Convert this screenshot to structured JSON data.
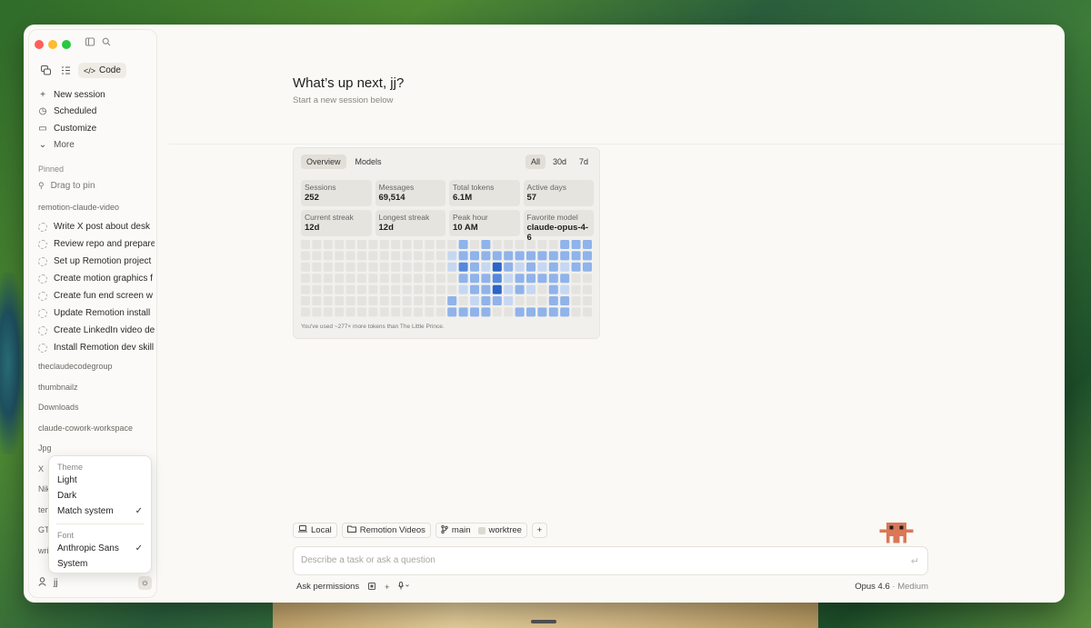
{
  "sidebar": {
    "mode_code_label": "Code",
    "nav": [
      {
        "icon": "plus-icon",
        "label": "New session"
      },
      {
        "icon": "clock-icon",
        "label": "Scheduled"
      },
      {
        "icon": "briefcase-icon",
        "label": "Customize"
      },
      {
        "icon": "chevron-down-icon",
        "label": "More"
      }
    ],
    "pinned_label": "Pinned",
    "pin_hint": "Drag to pin",
    "group_main": "remotion-claude-video",
    "sessions": [
      "Write X post about desk",
      "Review repo and prepare",
      "Set up Remotion project",
      "Create motion graphics f",
      "Create fun end screen w",
      "Update Remotion install",
      "Create LinkedIn video de",
      "Install Remotion dev skill"
    ],
    "groups": [
      "theclaudecodegroup",
      "thumbnailz",
      "Downloads",
      "claude-cowork-workspace",
      "Jpg",
      "X",
      "Nik",
      "ten",
      "GTN",
      "writ"
    ],
    "user_name": "jj"
  },
  "popup": {
    "theme_label": "Theme",
    "theme_options": [
      "Light",
      "Dark",
      "Match system"
    ],
    "font_label": "Font",
    "font_options": [
      "Anthropic Sans",
      "System"
    ]
  },
  "main": {
    "greeting": "What’s up next, jj?",
    "subtitle": "Start a new session below"
  },
  "stats": {
    "tabs": [
      "Overview",
      "Models"
    ],
    "ranges": [
      "All",
      "30d",
      "7d"
    ],
    "cards": [
      {
        "label": "Sessions",
        "value": "252"
      },
      {
        "label": "Messages",
        "value": "69,514"
      },
      {
        "label": "Total tokens",
        "value": "6.1M"
      },
      {
        "label": "Active days",
        "value": "57"
      },
      {
        "label": "Current streak",
        "value": "12d"
      },
      {
        "label": "Longest streak",
        "value": "12d"
      },
      {
        "label": "Peak hour",
        "value": "10 AM"
      },
      {
        "label": "Favorite model",
        "value": "claude-opus-4-6"
      }
    ],
    "heatmap_levels": [
      [
        0,
        0,
        0,
        0,
        0,
        0,
        0,
        0,
        0,
        0,
        0,
        0,
        0,
        0,
        2,
        0,
        2,
        0,
        0,
        0,
        0,
        0,
        0,
        2,
        2,
        2
      ],
      [
        0,
        0,
        0,
        0,
        0,
        0,
        0,
        0,
        0,
        0,
        0,
        0,
        0,
        1,
        2,
        2,
        2,
        2,
        2,
        2,
        2,
        2,
        2,
        2,
        2,
        2
      ],
      [
        0,
        0,
        0,
        0,
        0,
        0,
        0,
        0,
        0,
        0,
        0,
        0,
        0,
        1,
        3,
        2,
        1,
        4,
        2,
        1,
        2,
        1,
        2,
        1,
        2,
        2
      ],
      [
        0,
        0,
        0,
        0,
        0,
        0,
        0,
        0,
        0,
        0,
        0,
        0,
        0,
        0,
        2,
        2,
        2,
        3,
        1,
        2,
        2,
        2,
        2,
        2,
        0,
        0
      ],
      [
        0,
        0,
        0,
        0,
        0,
        0,
        0,
        0,
        0,
        0,
        0,
        0,
        0,
        0,
        1,
        2,
        2,
        4,
        1,
        2,
        1,
        0,
        2,
        1,
        0,
        0
      ],
      [
        0,
        0,
        0,
        0,
        0,
        0,
        0,
        0,
        0,
        0,
        0,
        0,
        0,
        2,
        0,
        1,
        2,
        2,
        1,
        0,
        0,
        0,
        2,
        2,
        0,
        0
      ],
      [
        0,
        0,
        0,
        0,
        0,
        0,
        0,
        0,
        0,
        0,
        0,
        0,
        0,
        2,
        2,
        2,
        2,
        0,
        0,
        2,
        2,
        2,
        2,
        2,
        0,
        0
      ]
    ],
    "level_colors": [
      "#e5e3df",
      "#c6d7f2",
      "#8fb3ea",
      "#5588dc",
      "#2c64c9"
    ],
    "note": "You've used ~277× more tokens than The Little Prince."
  },
  "context": {
    "location": "Local",
    "folder": "Remotion Videos",
    "branch": "main",
    "worktree": "worktree"
  },
  "prompt": {
    "placeholder": "Describe a task or ask a question"
  },
  "bottom": {
    "permissions": "Ask permissions",
    "model": "Opus 4.6",
    "effort": "· Medium"
  }
}
